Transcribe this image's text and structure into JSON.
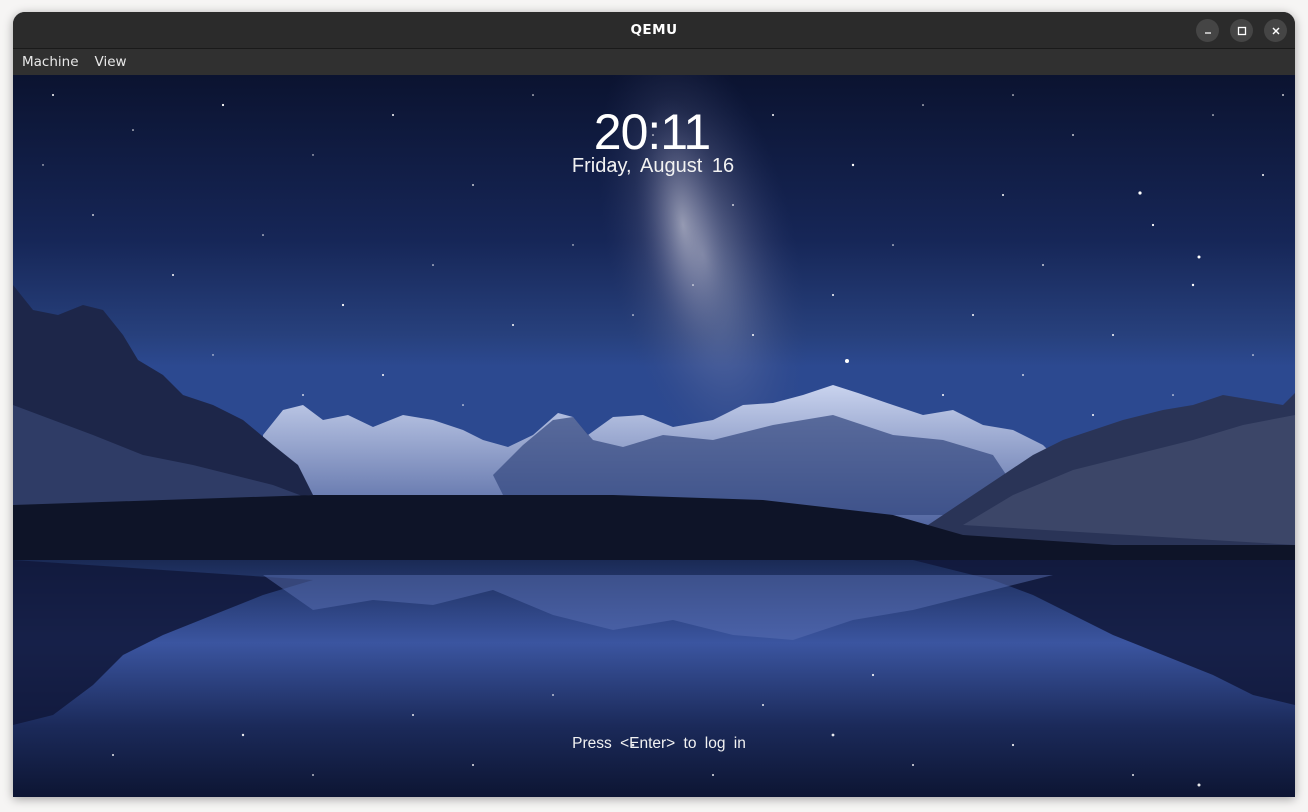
{
  "window": {
    "title": "QEMU",
    "controls": {
      "minimize_icon": "minimize-icon",
      "maximize_icon": "maximize-icon",
      "close_icon": "close-icon"
    }
  },
  "menubar": {
    "items": [
      {
        "label": "Machine"
      },
      {
        "label": "View"
      }
    ]
  },
  "lockscreen": {
    "time": "20:11",
    "date": "Friday, August 16",
    "prompt": "Press <Enter> to log in",
    "wallpaper": "starry-night-mountain-lake"
  },
  "colors": {
    "titlebar": "#2b2b2b",
    "menubar": "#303030",
    "sky_top": "#0e1733",
    "sky_mid": "#24386f"
  }
}
